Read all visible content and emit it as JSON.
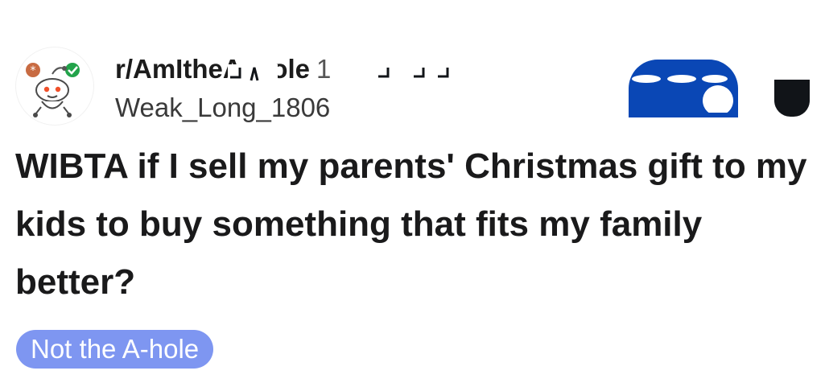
{
  "post": {
    "subreddit": "r/AmItheA    ole",
    "time": "1",
    "username": "Weak_Long_1806",
    "title": "WIBTA if I sell my parents' Christmas gift to my kids to buy something that fits my family better?",
    "flair": "Not the A-hole"
  },
  "icons": {
    "avatar": "snoo-avatar-icon",
    "join": "join-button-icon",
    "more": "more-icon"
  },
  "colors": {
    "join_blue": "#0a47b5",
    "flair_bg": "#7e96f1",
    "text_dark": "#1a1a1b",
    "avatar_orange": "#c86b42",
    "avatar_green": "#22a34a"
  }
}
